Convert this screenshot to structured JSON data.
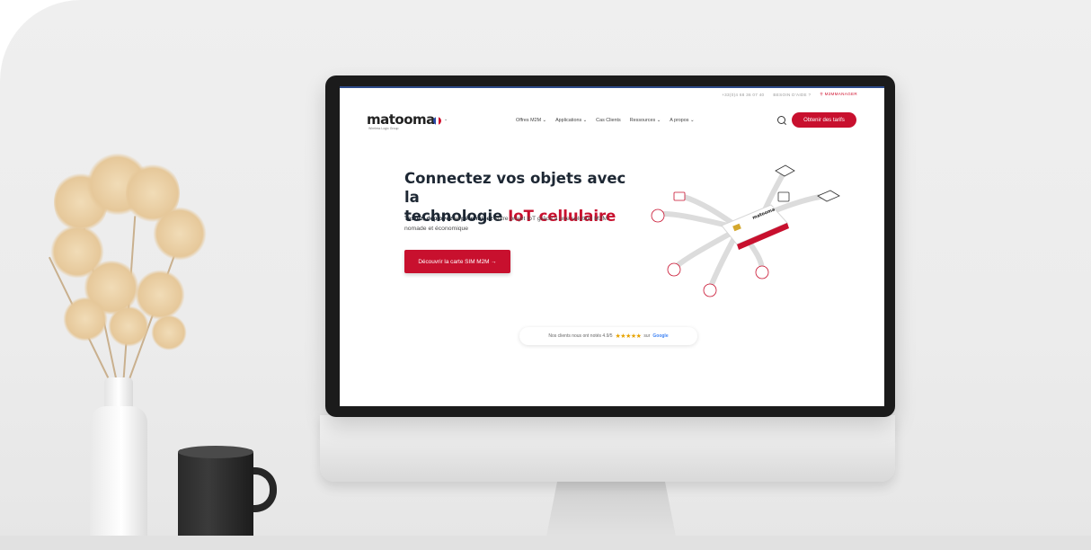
{
  "scene": {
    "description_items": [
      "monitor",
      "vase",
      "mug"
    ]
  },
  "website": {
    "topbar": {
      "phone": "+33(0)4 68 36 07 40",
      "help": "BESOIN D'AIDE ?",
      "account": "M2MMANAGER"
    },
    "logo": {
      "text": "matooma",
      "subtext": "Wireless Logic Group"
    },
    "menu": [
      "Offres M2M ⌄",
      "Applications ⌄",
      "Cas Clients",
      "Ressources ⌄",
      "A propos ⌄"
    ],
    "cta_top": "Obtenir des tarifs",
    "hero": {
      "title_line1": "Connectez vos objets avec la",
      "title_line2_plain": "technologie ",
      "title_line2_accent": "IoT cellulaire",
      "sub_bold1": "Testez",
      "sub_sep1": ", ",
      "sub_bold2": "déployez",
      "sub_sep2": " et ",
      "sub_bold3": "pérennisez",
      "sub_rest": " votre projet IoT grâce à une solution M2M nomade et économique",
      "button": "Découvrir la carte SIM M2M →"
    },
    "rating": {
      "text": "Nos clients nous ont notés 4.9/5",
      "stars": "★★★★★",
      "suffix": "sur",
      "brand": "Google"
    }
  },
  "colors": {
    "accent": "#c8102e",
    "title": "#1d2733",
    "topbar_line": "#2d4b8a"
  }
}
